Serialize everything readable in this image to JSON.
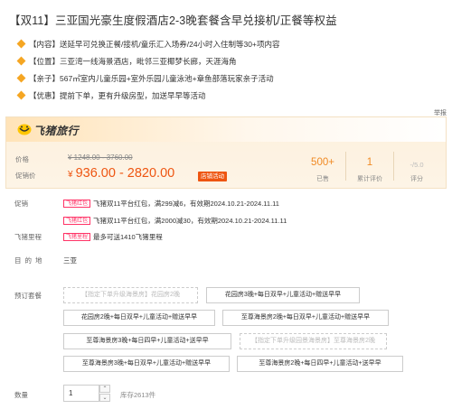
{
  "product": {
    "title": "【双11】三亚国光豪生度假酒店2-3晚套餐含早兑接机/正餐等权益"
  },
  "highlights": [
    {
      "tag": "【内容】",
      "text": "送延早可兑换正餐/接机/童乐汇入场券/24小时入住制等30+项内容"
    },
    {
      "tag": "【位置】",
      "text": "三亚湾一线海景酒店，毗邻三亚椰梦长廊，天涯海角"
    },
    {
      "tag": "【亲子】",
      "text": "567㎡室内儿童乐园+室外乐园儿童泳池+章鱼部落玩家亲子活动"
    },
    {
      "tag": "【优惠】",
      "text": "提前下单，更有升级房型，加送早早等活动"
    }
  ],
  "report_label": "举报",
  "brand": {
    "name": "飞猪旅行",
    "color": "#ffc600"
  },
  "pricing": {
    "price_label": "价格",
    "original_price": "¥ 1248.00 - 3760.00",
    "promo_label": "促销价",
    "currency": "¥",
    "promo_price": "936.00 - 2820.00",
    "promo_badge": "店铺活动",
    "accent_color": "#ee5511"
  },
  "stats": [
    {
      "value": "500+",
      "caption": "已售"
    },
    {
      "value": "1",
      "caption": "累计评价"
    },
    {
      "value": "-/5.0",
      "caption": "评分"
    }
  ],
  "promotions": {
    "label": "促销",
    "items": [
      {
        "tag": "飞猪红包",
        "text": "飞猪双11平台红包，满299减6，有效期2024.10.21-2024.11.11"
      },
      {
        "tag": "飞猪红包",
        "text": "飞猪双11平台红包，满2000减30，有效期2024.10.21-2024.11.11"
      }
    ]
  },
  "mileage": {
    "label": "飞猪里程",
    "tag": "飞猪里程",
    "text": "最多可送1410飞猪里程"
  },
  "destination": {
    "label": "目的地",
    "value": "三亚"
  },
  "packages": {
    "label": "预订套餐",
    "options": [
      {
        "text": "【指定下单升级海景房】花园房2晚",
        "disabled": true
      },
      {
        "text": "花园房3晚+每日双早+儿童活动+赠送早早",
        "disabled": false
      },
      {
        "text": "花园房2晚+每日双早+儿童活动+赠送早早",
        "disabled": false
      },
      {
        "text": "至尊海景房2晚+每日双早+儿童活动+赠送早早",
        "disabled": false
      },
      {
        "text": "至尊海景房3晚+每日四早+儿童活动+送早早",
        "disabled": false
      },
      {
        "text": "【指定下单升级园景海景房】至尊海景房2晚",
        "disabled": true
      },
      {
        "text": "至尊海景房3晚+每日双早+儿童活动+赠送早早",
        "disabled": false
      },
      {
        "text": "至尊海景房2晚+每日四早+儿童活动+送早早",
        "disabled": false
      }
    ]
  },
  "quantity": {
    "label": "数量",
    "value": "1",
    "up": "⌃",
    "down": "⌄",
    "stock": "库存2613件"
  }
}
